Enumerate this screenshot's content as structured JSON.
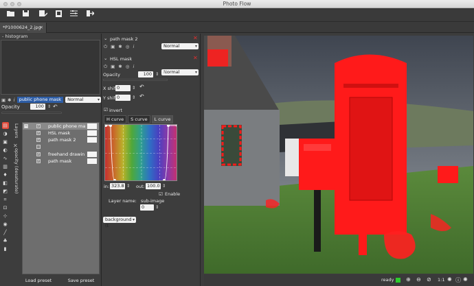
{
  "window": {
    "title": "Photo Flow"
  },
  "toolbar": {
    "buttons": [
      "folder-open-icon",
      "save-icon",
      "save-as-icon",
      "export-icon",
      "settings-icon",
      "exit-icon"
    ]
  },
  "tab": {
    "label": "*P1000624_2.jpg",
    "close": "✕"
  },
  "histogram": {
    "label": "histogram",
    "collapse": "-"
  },
  "layer_controls": {
    "name": "public phone mask",
    "blend": "Normal",
    "opacity_label": "Opacity",
    "opacity_value": "100"
  },
  "sidebar": {
    "layers_label": "Layers",
    "filter_label": "opacity (desaturate)"
  },
  "layers": [
    {
      "name": "public phone ma",
      "checked": true,
      "group": true
    },
    {
      "name": "HSL mask",
      "checked": true
    },
    {
      "name": "path mask 2",
      "checked": true
    },
    {
      "name": "",
      "checked": false
    },
    {
      "name": "freehand drawin",
      "checked": true
    },
    {
      "name": "path mask",
      "checked": true
    }
  ],
  "bottom_buttons": {
    "load": "Load preset",
    "save": "Save preset"
  },
  "path_mask_2": {
    "title": "path mask 2",
    "blend": "Normal"
  },
  "hsl_mask": {
    "title": "HSL mask",
    "blend": "Normal",
    "opacity_label": "Opacity",
    "opacity_value": "100",
    "xshift_label": "X shift",
    "xshift_value": "0",
    "yshift_label": "Y shift",
    "yshift_value": "0",
    "invert_label": "invert",
    "curve_tabs": [
      "H curve",
      "S curve",
      "L curve"
    ],
    "in_label": "in:",
    "in_value": "323.8",
    "out_label": "out:",
    "out_value": "100.0",
    "enable_label": "Enable",
    "layer_name_label": "Layer name:",
    "layer_name_value": "sub-image",
    "background_value": "background (t",
    "background_num": "0"
  },
  "status": {
    "text": "ready",
    "zoom_1_1": "1:1",
    "colors": {
      "ready_indicator": "#2ecc2e"
    }
  },
  "colors": {
    "accent": "#2d5da6",
    "mask_red": "#ff1a1a",
    "close_red": "#e03030"
  }
}
